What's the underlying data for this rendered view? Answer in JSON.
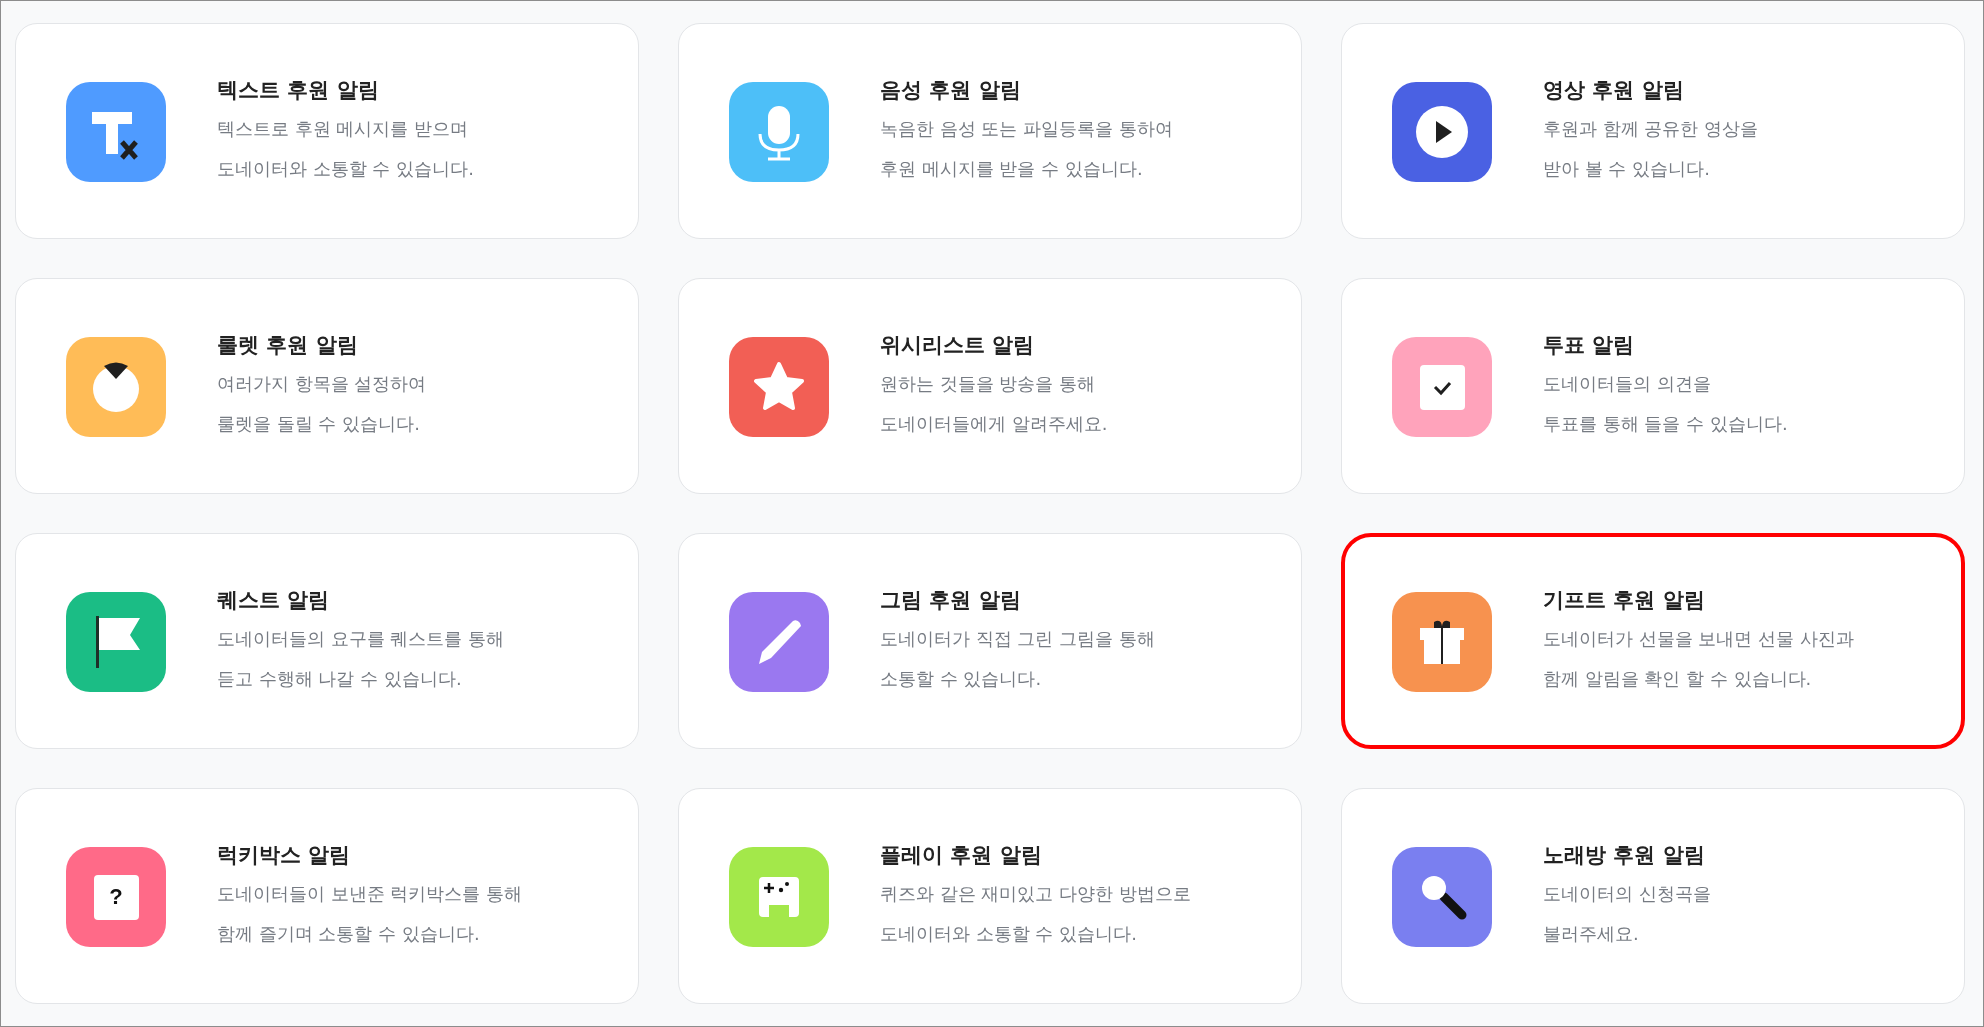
{
  "cards": [
    {
      "kind": "text",
      "color": "#4f9bff",
      "title": "텍스트 후원 알림",
      "lines": [
        "텍스트로 후원 메시지를 받으며",
        "도네이터와 소통할 수 있습니다."
      ],
      "highlighted": false
    },
    {
      "kind": "microphone",
      "color": "#4dbff8",
      "title": "음성 후원 알림",
      "lines": [
        "녹음한 음성 또는 파일등록을 통하여",
        "후원 메시지를 받을 수 있습니다."
      ],
      "highlighted": false
    },
    {
      "kind": "play",
      "color": "#4a61e3",
      "title": "영상 후원 알림",
      "lines": [
        "후원과 함께 공유한 영상을",
        "받아 볼 수 있습니다."
      ],
      "highlighted": false
    },
    {
      "kind": "roulette",
      "color": "#ffbc57",
      "title": "룰렛 후원 알림",
      "lines": [
        "여러가지 항목을 설정하여",
        "룰렛을 돌릴 수 있습니다."
      ],
      "highlighted": false
    },
    {
      "kind": "star",
      "color": "#f25f55",
      "title": "위시리스트 알림",
      "lines": [
        "원하는 것들을 방송을 통해",
        "도네이터들에게 알려주세요."
      ],
      "highlighted": false
    },
    {
      "kind": "check",
      "color": "#ffa3bb",
      "title": "투표 알림",
      "lines": [
        "도네이터들의 의견을",
        "투표를 통해 들을 수 있습니다."
      ],
      "highlighted": false
    },
    {
      "kind": "flag",
      "color": "#1bbd85",
      "title": "퀘스트 알림",
      "lines": [
        "도네이터들의 요구를 퀘스트를 통해",
        "듣고 수행해 나갈 수 있습니다."
      ],
      "highlighted": false
    },
    {
      "kind": "pencil",
      "color": "#9a78f0",
      "title": "그림 후원 알림",
      "lines": [
        "도네이터가 직접 그린 그림을 통해",
        "소통할 수 있습니다."
      ],
      "highlighted": false
    },
    {
      "kind": "gift",
      "color": "#f7924f",
      "title": "기프트 후원 알림",
      "lines": [
        "도네이터가 선물을 보내면 선물 사진과",
        "함께 알림을 확인 할 수 있습니다."
      ],
      "highlighted": true
    },
    {
      "kind": "question",
      "icon_text": "?",
      "color": "#ff6a88",
      "title": "럭키박스 알림",
      "lines": [
        "도네이터들이 보낸준 럭키박스를 통해",
        "함께 즐기며 소통할 수 있습니다."
      ],
      "highlighted": false
    },
    {
      "kind": "gamepad",
      "color": "#a3e84a",
      "title": "플레이 후원 알림",
      "lines": [
        "퀴즈와 같은 재미있고 다양한 방법으로",
        "도네이터와 소통할 수 있습니다."
      ],
      "highlighted": false
    },
    {
      "kind": "karaoke",
      "color": "#7a7ff0",
      "title": "노래방 후원 알림",
      "lines": [
        "도네이터의 신청곡을",
        "불러주세요."
      ],
      "highlighted": false
    }
  ]
}
